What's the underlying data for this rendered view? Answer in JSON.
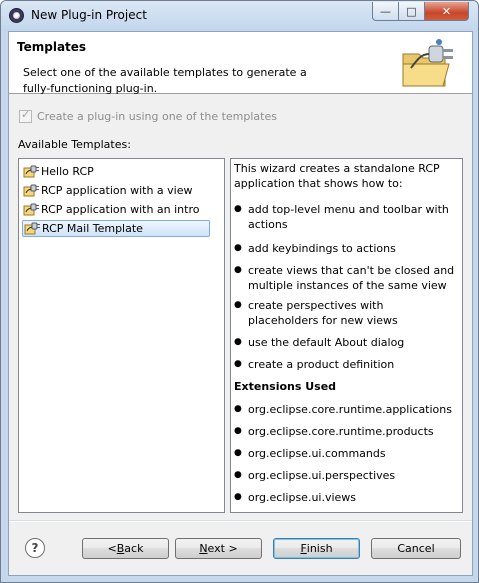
{
  "window": {
    "title": "New Plug-in Project"
  },
  "header": {
    "title": "Templates",
    "description": "Select one of the available templates to generate a fully-functioning plug-in."
  },
  "checkbox": {
    "label": "Create a plug-in using one of the templates",
    "checked": true,
    "enabled": false
  },
  "templates": {
    "label": "Available Templates:",
    "items": [
      "Hello RCP",
      "RCP application with a view",
      "RCP application with an intro",
      "RCP Mail Template"
    ],
    "selected": "RCP Mail Template"
  },
  "description_panel": {
    "intro": "This wizard creates a standalone RCP application that shows how to:",
    "bullets": [
      "add top-level menu and toolbar with actions",
      "add keybindings to actions",
      "create views that can't be closed and multiple instances of the same view",
      "create perspectives with placeholders for new views",
      "use the default About dialog",
      "create a product definition"
    ],
    "extensions_heading": "Extensions Used",
    "extensions": [
      "org.eclipse.core.runtime.applications",
      "org.eclipse.core.runtime.products",
      "org.eclipse.ui.commands",
      "org.eclipse.ui.perspectives",
      "org.eclipse.ui.views"
    ]
  },
  "buttons": {
    "back": {
      "mnemonic": "B",
      "rest": "ack",
      "prefix": "< "
    },
    "next": {
      "mnemonic": "N",
      "rest": "ext >"
    },
    "finish": {
      "mnemonic": "F",
      "rest": "inish"
    },
    "cancel": "Cancel",
    "help": "?"
  },
  "window_controls": {
    "minimize": "—",
    "maximize": "□",
    "close": "✕"
  }
}
